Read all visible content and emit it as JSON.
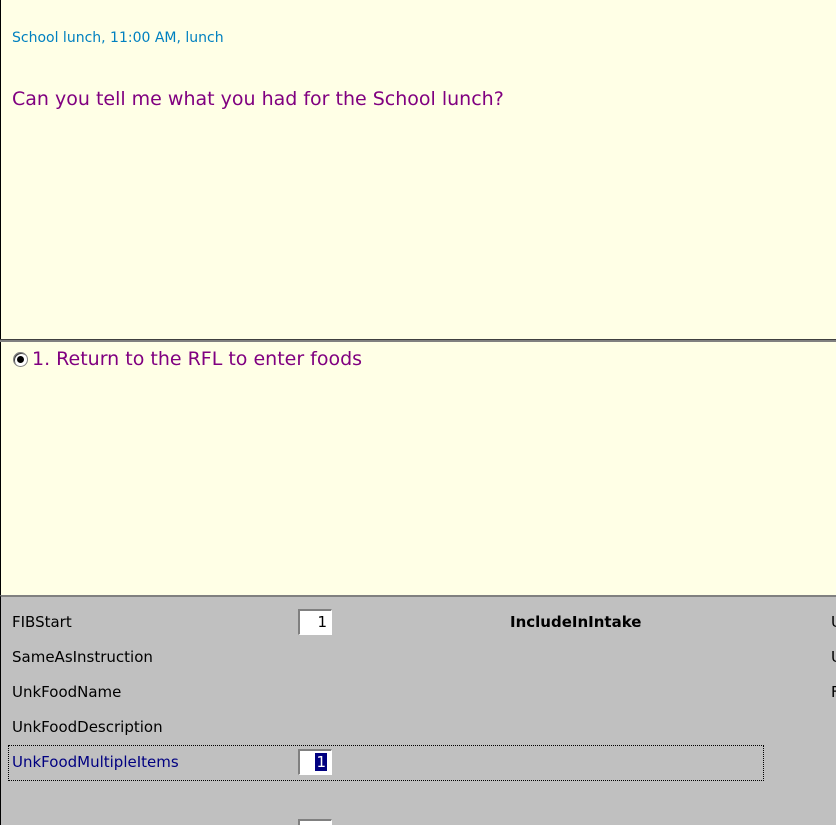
{
  "question": {
    "context": "School lunch, 11:00 AM, lunch",
    "text": "Can you tell me what you had for the School lunch?"
  },
  "answers": [
    {
      "label": "1.  Return to the RFL to enter foods",
      "selected": true
    }
  ],
  "fields": {
    "fib_start": {
      "label": "FIBStart",
      "value": "1"
    },
    "include_in_intake": {
      "label": "IncludeInIntake"
    },
    "same_as_instruction": {
      "label": "SameAsInstruction"
    },
    "unk_food_name": {
      "label": "UnkFoodName"
    },
    "unk_food_description": {
      "label": "UnkFoodDescription"
    },
    "unk_food_multiple_items": {
      "label": "UnkFoodMultipleItems",
      "value": "1"
    },
    "clipped_right": [
      "U",
      "U",
      "F"
    ]
  },
  "colors": {
    "panel_bg": "#ffffe6",
    "context_text": "#0080c0",
    "question_text": "#800080",
    "grid_bg": "#c0c0c0",
    "active_label": "#000080"
  }
}
